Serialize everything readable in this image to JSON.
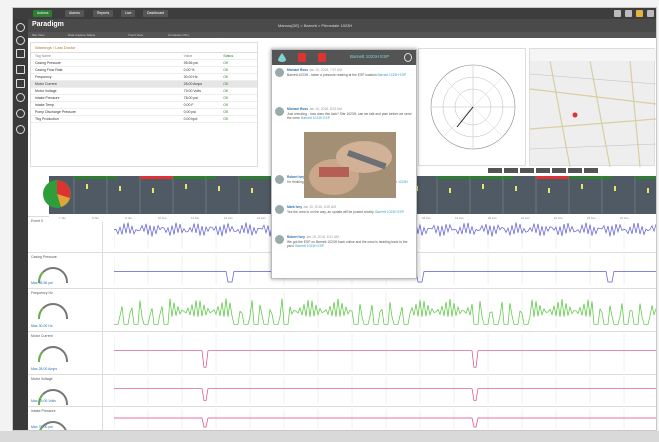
{
  "topbar": {
    "tabs": [
      "Actions",
      "Alarms",
      "Reports",
      "Live",
      "Dashboard"
    ]
  },
  "header": {
    "logo": "Paradigm",
    "breadcrumb": "Mamos(DE) > Barnett > Primedale 1023H",
    "watermark": "ANALYSIS"
  },
  "subnav": {
    "items": [
      "Site View",
      "Data Capture Status",
      "Trend View",
      "Correlation Plot"
    ]
  },
  "left_panel": {
    "title": "Warnings / Last Doctor",
    "columns": [
      "Tag Name",
      "Value",
      "Status"
    ],
    "rows": [
      {
        "name": "Casing Pressure",
        "value": "95.56 psi",
        "status": "OK",
        "selected": false
      },
      {
        "name": "Casing Flow Rate",
        "value": "0.00 %",
        "status": "OK",
        "selected": false
      },
      {
        "name": "Frequency",
        "value": "30.00 Hz",
        "status": "OK",
        "selected": false
      },
      {
        "name": "Motor Current",
        "value": "28.00 Amps",
        "status": "OK",
        "selected": true
      },
      {
        "name": "Motor Voltage",
        "value": "79.00 Volts",
        "status": "OK",
        "selected": false
      },
      {
        "name": "Intake Pressure",
        "value": "78.00 psi",
        "status": "OK",
        "selected": false
      },
      {
        "name": "Intake Temp",
        "value": "0.00 F",
        "status": "OK",
        "selected": false
      },
      {
        "name": "Pump Discharge Pressure",
        "value": "0.00 psi",
        "status": "OK",
        "selected": false
      },
      {
        "name": "Tbg Production",
        "value": "0.00 bpd",
        "status": "OK",
        "selected": false
      }
    ]
  },
  "popup": {
    "title": "Barnett 1023H ESP",
    "messages": [
      {
        "who": "Michael Ross",
        "time": "Jan 15, 2018, 7:57 AM",
        "text": "Barnett 1023H - taken a pressure reading at the ESP location",
        "link": "Barnett 1023H ESP"
      },
      {
        "who": "Michael Ross",
        "time": "Jan 15, 2018, 8:02 AM",
        "text": "Just checking - how does this look? Site 1023H, can we talk and plan before we send the crew.",
        "link": "Barnett 1023H ESP"
      },
      {
        "who": "Robert Ivey",
        "time": "Jan 15, 2018, 8:14 AM",
        "text": "I'm thinking we should call the crew now before the well goes down.",
        "link": "Barnett 1023H"
      },
      {
        "who": "Mark Ivey",
        "time": "Jan 15, 2018, 8:20 AM",
        "text": "Yes the crew is on the way, an update will be posted shortly.",
        "link": "Barnett 1023H ESP"
      },
      {
        "who": "Robert Ivey",
        "time": "Jan 15, 2018, 8:31 AM",
        "text": "We got the ESP on Barnett 1023H back online and the crew is heading back to the yard.",
        "link": "Barnett 1023H ESP"
      }
    ]
  },
  "timeline_labels": [
    "7 Jan",
    "8 Jan",
    "9 Jan",
    "10 Jan",
    "11 Jan",
    "12 Jan",
    "13 Jan",
    "14 Jan",
    "15 Jan",
    "16 Jan",
    "17 Jan",
    "18 Jan",
    "19 Jan",
    "20 Jan",
    "21 Jan",
    "22 Jan",
    "23 Jan",
    "24 Jan"
  ],
  "sections": [
    {
      "label": "Event 0",
      "value": "",
      "color": "#5b5bd6"
    },
    {
      "label": "Casing Pressure",
      "value": "Max 95.56 psi",
      "color": "#5b5bd6"
    },
    {
      "label": "Frequency Hz",
      "value": "Max 30.00 Hz",
      "color": "#53c43b"
    },
    {
      "label": "Motor Current",
      "value": "Max 28.00 Amps",
      "color": "#e0457b"
    },
    {
      "label": "Motor Voltage",
      "value": "Max 79.00 Volts",
      "color": "#e0457b"
    },
    {
      "label": "Intake Pressure",
      "value": "Max 78.00 psi",
      "color": "#e0457b"
    }
  ],
  "colors": {
    "brand_green": "#2e7d32",
    "chat_teal": "#7fd3d0",
    "series_blue": "#5b5bd6",
    "series_green": "#53c43b",
    "series_pink": "#e0457b"
  }
}
